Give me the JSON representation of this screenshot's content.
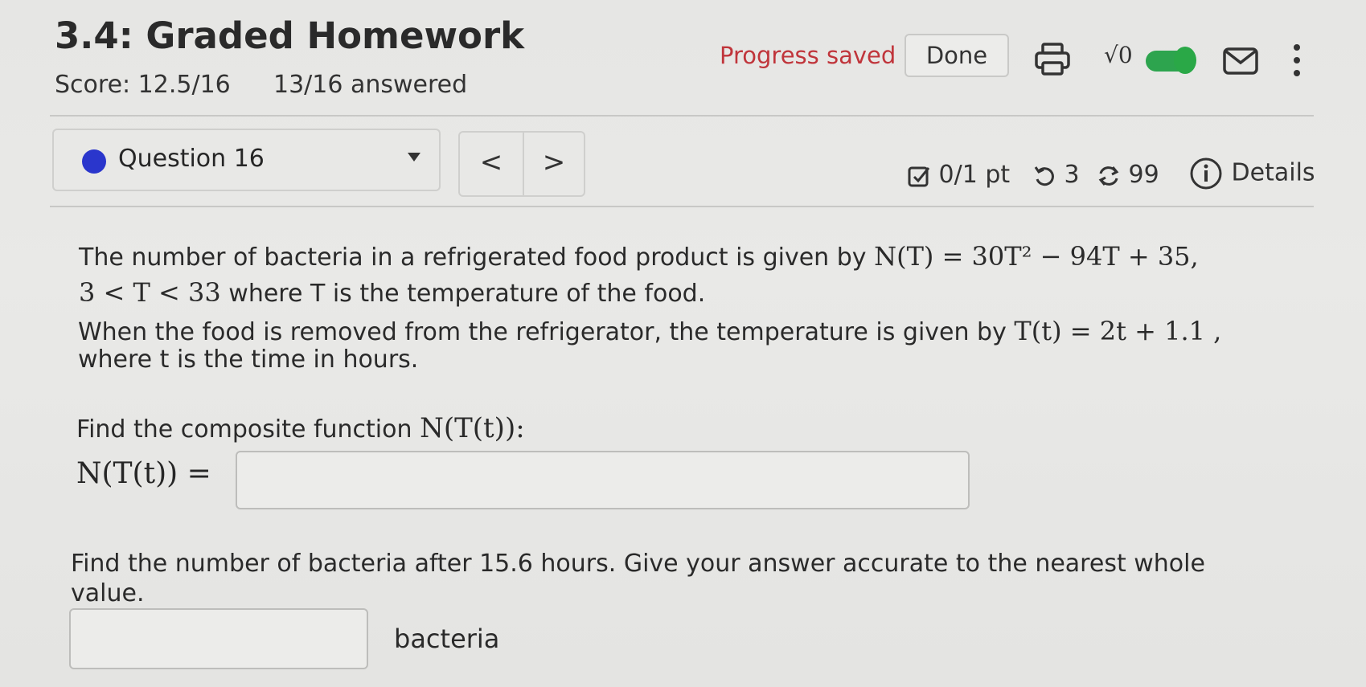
{
  "header": {
    "title": "3.4: Graded Homework",
    "score": "Score: 12.5/16",
    "answered": "13/16 answered",
    "progress_status": "Progress saved",
    "done_label": "Done",
    "sqrt_label": "√0",
    "toggle_on": true,
    "accent_color": "#2a36cc",
    "progress_color": "#c0353b",
    "toggle_color": "#2da44e"
  },
  "question_nav": {
    "selected": "Question 16",
    "prev": "<",
    "next": ">"
  },
  "meta": {
    "points": "0/1 pt",
    "retries": "3",
    "attempts": "99",
    "details": "Details"
  },
  "problem": {
    "p1_text": "The number of bacteria in a refrigerated food product is given by",
    "p1_math": "N(T) = 30T² − 94T + 35,",
    "p2_math": "3 < T < 33",
    "p2_text": "where T is the temperature of the food.",
    "p3_text": "When the food is removed from the refrigerator, the temperature is given by",
    "p3_math": "T(t) = 2t + 1.1 ,",
    "p4_text": "where t is the time in hours.",
    "part1_prompt": "Find the composite function",
    "part1_math": "N(T(t)):",
    "part1_label": "N(T(t)) =",
    "part1_value": "",
    "part2_prompt_line1": "Find the number of bacteria after 15.6 hours. Give your answer accurate to the nearest whole",
    "part2_prompt_line2": "value.",
    "part2_value": "",
    "part2_unit": "bacteria"
  }
}
